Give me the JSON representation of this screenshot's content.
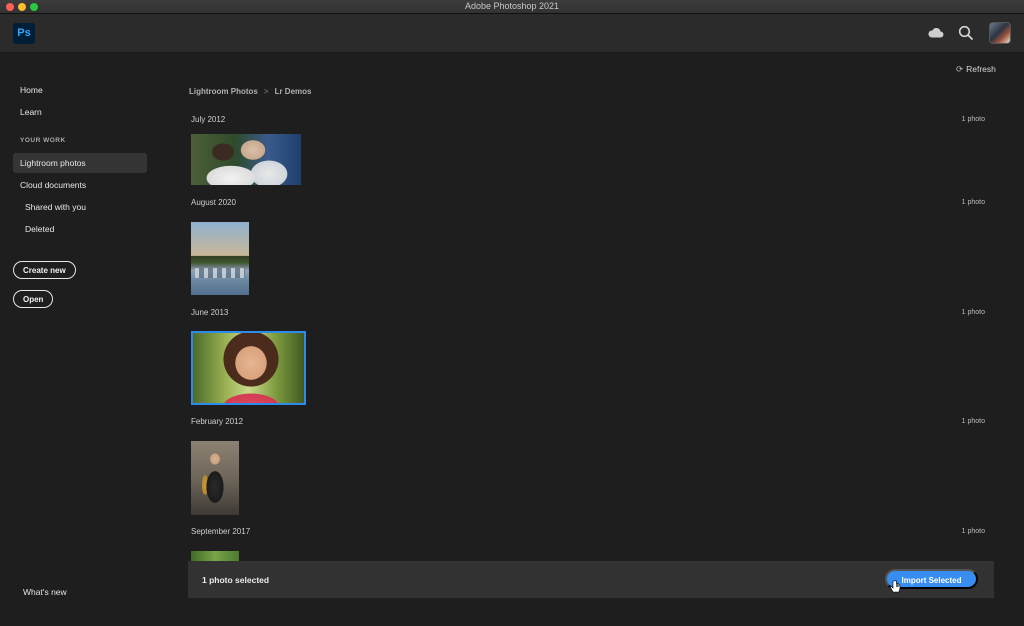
{
  "window": {
    "title": "Adobe Photoshop 2021"
  },
  "app": {
    "logo": "Ps",
    "brand_color": "#31a8ff",
    "header_icons": [
      "cloud-icon",
      "search-icon",
      "avatar"
    ]
  },
  "sidebar": {
    "home": "Home",
    "learn": "Learn",
    "section": "YOUR WORK",
    "lightroom": "Lightroom photos",
    "cloud_docs": "Cloud documents",
    "shared": "Shared with you",
    "deleted": "Deleted",
    "create_new": "Create new",
    "open": "Open",
    "whats_new": "What's new"
  },
  "main": {
    "refresh": "Refresh",
    "breadcrumb": {
      "root": "Lightroom Photos",
      "separator": ">",
      "current": "Lr Demos"
    },
    "groups": [
      {
        "date": "July 2012",
        "count": "1 photo"
      },
      {
        "date": "August 2020",
        "count": "1 photo"
      },
      {
        "date": "June 2013",
        "count": "1 photo",
        "selected": true
      },
      {
        "date": "February 2012",
        "count": "1 photo"
      },
      {
        "date": "September 2017",
        "count": "1 photo"
      }
    ]
  },
  "footer": {
    "selection": "1 photo selected",
    "import_button": "Import Selected",
    "accent": "#378ef0"
  }
}
